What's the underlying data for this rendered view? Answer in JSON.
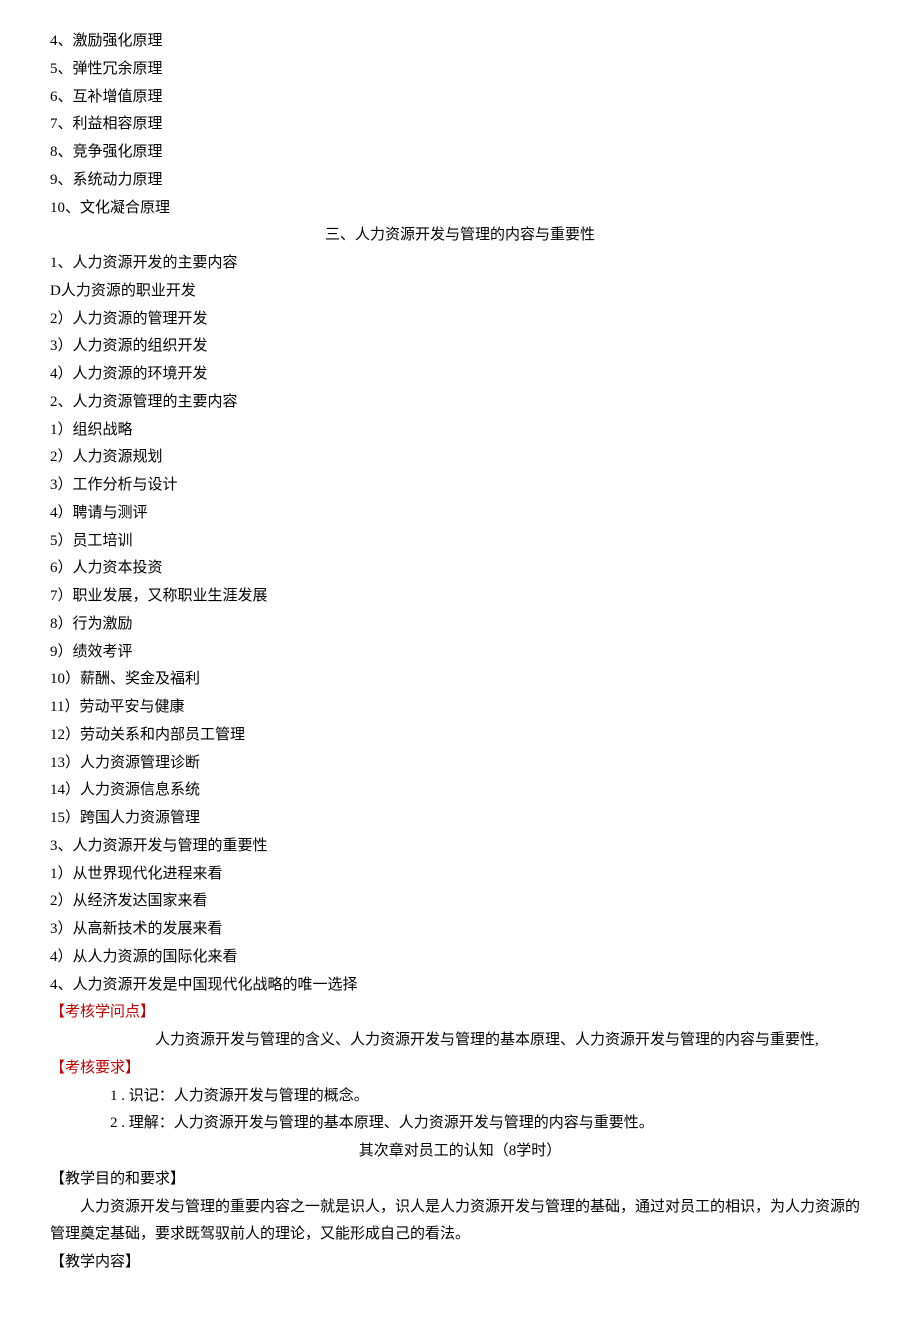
{
  "top_list": [
    "4、激励强化原理",
    "5、弹性冗余原理",
    "6、互补增值原理",
    "7、利益相容原理",
    "8、竞争强化原理",
    "9、系统动力原理",
    "10、文化凝合原理"
  ],
  "section3_title": "三、人力资源开发与管理的内容与重要性",
  "section3_lines": [
    "1、人力资源开发的主要内容",
    "D人力资源的职业开发",
    "2）人力资源的管理开发",
    "3）人力资源的组织开发",
    "4）人力资源的环境开发",
    "2、人力资源管理的主要内容",
    "1）组织战略",
    "2）人力资源规划",
    "3）工作分析与设计",
    "4）聘请与测评",
    "5）员工培训",
    "6）人力资本投资",
    "7）职业发展，又称职业生涯发展",
    "8）行为激励",
    "9）绩效考评",
    "10）薪酬、奖金及福利",
    "11）劳动平安与健康",
    "12）劳动关系和内部员工管理",
    "13）人力资源管理诊断",
    "14）人力资源信息系统",
    "15）跨国人力资源管理",
    "3、人力资源开发与管理的重要性",
    "1）从世界现代化进程来看",
    "2）从经济发达国家来看",
    "3）从高新技术的发展来看",
    "4）从人力资源的国际化来看",
    "4、人力资源开发是中国现代化战略的唯一选择"
  ],
  "assess_points_label": "【考核学问点】",
  "assess_points_text": "人力资源开发与管理的含义、人力资源开发与管理的基本原理、人力资源开发与管理的内容与重要性,",
  "assess_req_label": "【考核要求】",
  "assess_req_items": [
    "1 . 识记：人力资源开发与管理的概念。",
    "2 . 理解：人力资源开发与管理的基本原理、人力资源开发与管理的内容与重要性。"
  ],
  "chapter_title": "其次章对员工的认知（8学时）",
  "teach_goal_label": "【教学目的和要求】",
  "teach_goal_text": "人力资源开发与管理的重要内容之一就是识人，识人是人力资源开发与管理的基础，通过对员工的相识，为人力资源的管理奠定基础，要求既驾驭前人的理论，又能形成自己的看法。",
  "teach_content_label": "【教学内容】"
}
